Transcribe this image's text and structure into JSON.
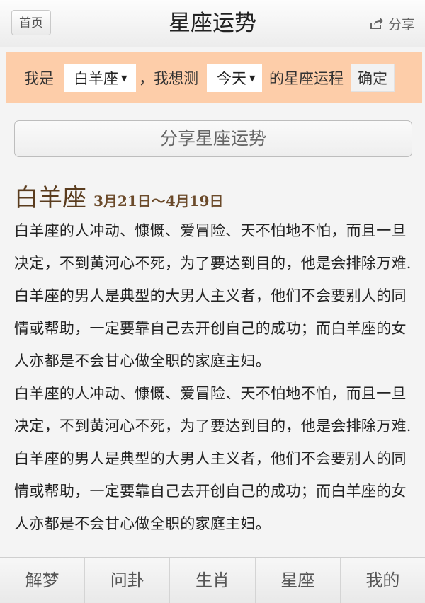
{
  "header": {
    "home_label": "首页",
    "title": "星座运势",
    "share_label": "分享"
  },
  "selector": {
    "prefix": "我是",
    "sign_value": "白羊座",
    "middle": "，我想测",
    "period_value": "今天",
    "suffix": "的星座运程",
    "confirm_label": "确定"
  },
  "share_button_label": "分享星座运势",
  "sign": {
    "name": "白羊座",
    "date_range": "3月21日～4月19日",
    "paragraphs": [
      "白羊座的人冲动、慷慨、爱冒险、天不怕地不怕，而且一旦决定，不到黄河心不死，为了要达到目的，他是会排除万难. 白羊座的男人是典型的大男人主义者，他们不会要别人的同情或帮助，一定要靠自己去开创自己的成功；而白羊座的女人亦都是不会甘心做全职的家庭主妇。",
      "白羊座的人冲动、慷慨、爱冒险、天不怕地不怕，而且一旦决定，不到黄河心不死，为了要达到目的，他是会排除万难. 白羊座的男人是典型的大男人主义者，他们不会要别人的同情或帮助，一定要靠自己去开创自己的成功；而白羊座的女人亦都是不会甘心做全职的家庭主妇。"
    ]
  },
  "bottom_nav": [
    {
      "label": "解梦"
    },
    {
      "label": "问卦"
    },
    {
      "label": "生肖"
    },
    {
      "label": "星座"
    },
    {
      "label": "我的"
    }
  ]
}
